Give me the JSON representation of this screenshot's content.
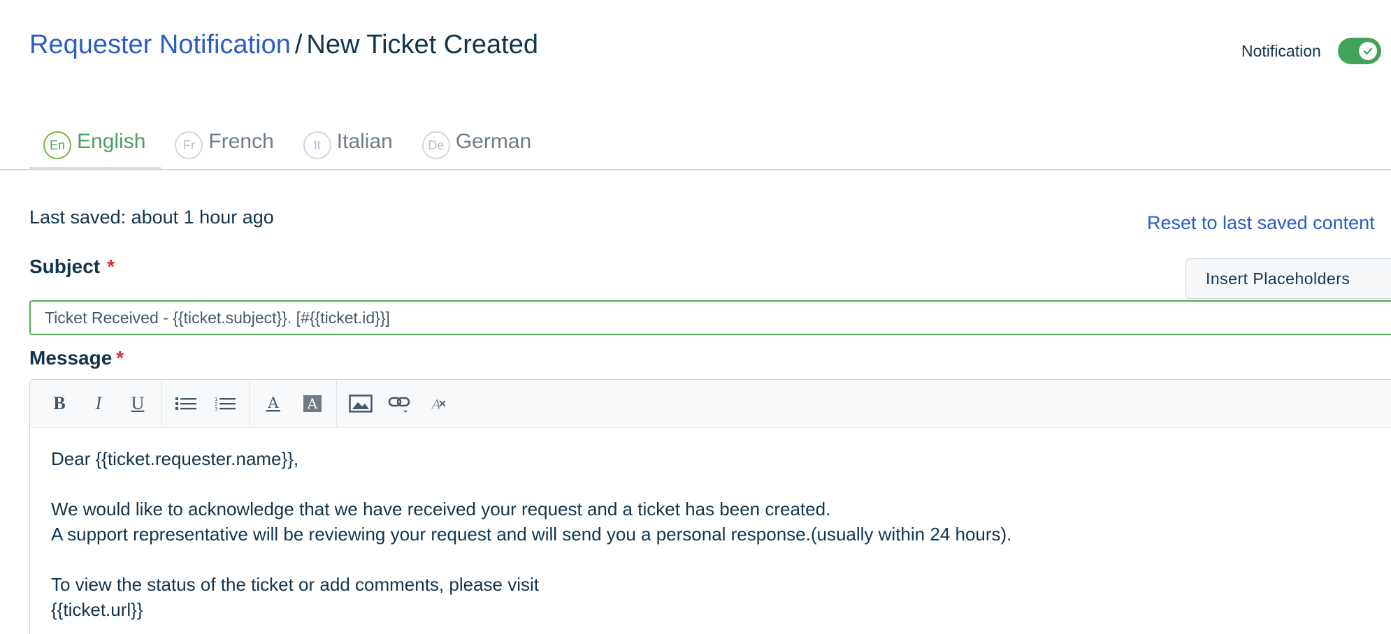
{
  "header": {
    "breadcrumb_link": "Requester Notification",
    "separator": "/",
    "current": "New Ticket Created"
  },
  "notification": {
    "label": "Notification",
    "enabled": true,
    "toggle_color": "#41a35a"
  },
  "tabs": [
    {
      "code": "En",
      "label": "English",
      "active": true
    },
    {
      "code": "Fr",
      "label": "French",
      "active": false
    },
    {
      "code": "It",
      "label": "Italian",
      "active": false
    },
    {
      "code": "De",
      "label": "German",
      "active": false
    }
  ],
  "status": {
    "last_saved": "Last saved: about 1 hour ago",
    "reset_link": "Reset to last saved content"
  },
  "subject": {
    "label": "Subject",
    "required_mark": "*",
    "value": "Ticket Received - {{ticket.subject}}. [#{{ticket.id}}]",
    "insert_button": "Insert Placeholders"
  },
  "message": {
    "label": "Message",
    "required_mark": "*",
    "toolbar": {
      "bold": "B",
      "italic": "I",
      "underline": "U",
      "icons": [
        "bold-icon",
        "italic-icon",
        "underline-icon",
        "bulleted-list-icon",
        "numbered-list-icon",
        "font-color-icon",
        "background-color-icon",
        "insert-image-icon",
        "insert-link-icon",
        "clear-formatting-icon"
      ]
    },
    "body_lines": [
      "Dear {{ticket.requester.name}},",
      "",
      "We would like to acknowledge that we have received your request and a ticket has been created.",
      "A support representative will be reviewing your request and will send you a personal response.(usually within 24 hours).",
      "",
      "To view the status of the ticket or add comments, please visit",
      "{{ticket.url}}"
    ]
  },
  "colors": {
    "link": "#2c5cc5",
    "active_tab": "#4ca160",
    "required": "#d72d30",
    "input_focus_border": "#4caf50"
  }
}
